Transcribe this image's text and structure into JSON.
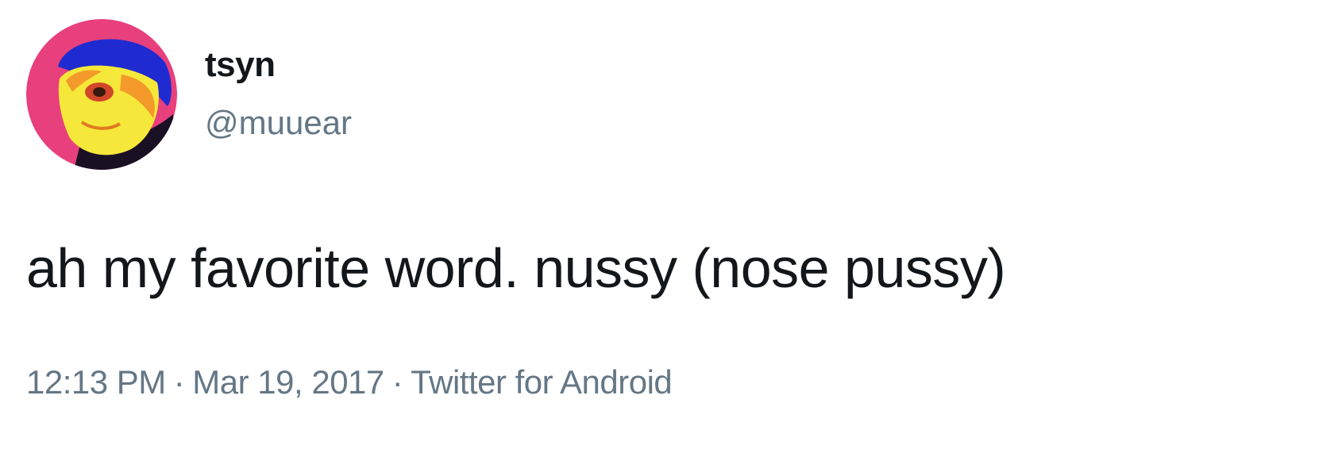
{
  "user": {
    "display_name": "tsyn",
    "handle": "@muuear",
    "avatar_icon": "profile-avatar"
  },
  "tweet": {
    "text": "ah my favorite word.  nussy (nose pussy)",
    "time": "12:13 PM",
    "separator": "·",
    "date": "Mar 19, 2017",
    "source": "Twitter for Android"
  },
  "colors": {
    "text_primary": "#14171a",
    "text_secondary": "#657786",
    "avatar_ring": "#e8407c",
    "avatar_hair": "#1f2bd0",
    "avatar_skin": "#f6e83a"
  }
}
